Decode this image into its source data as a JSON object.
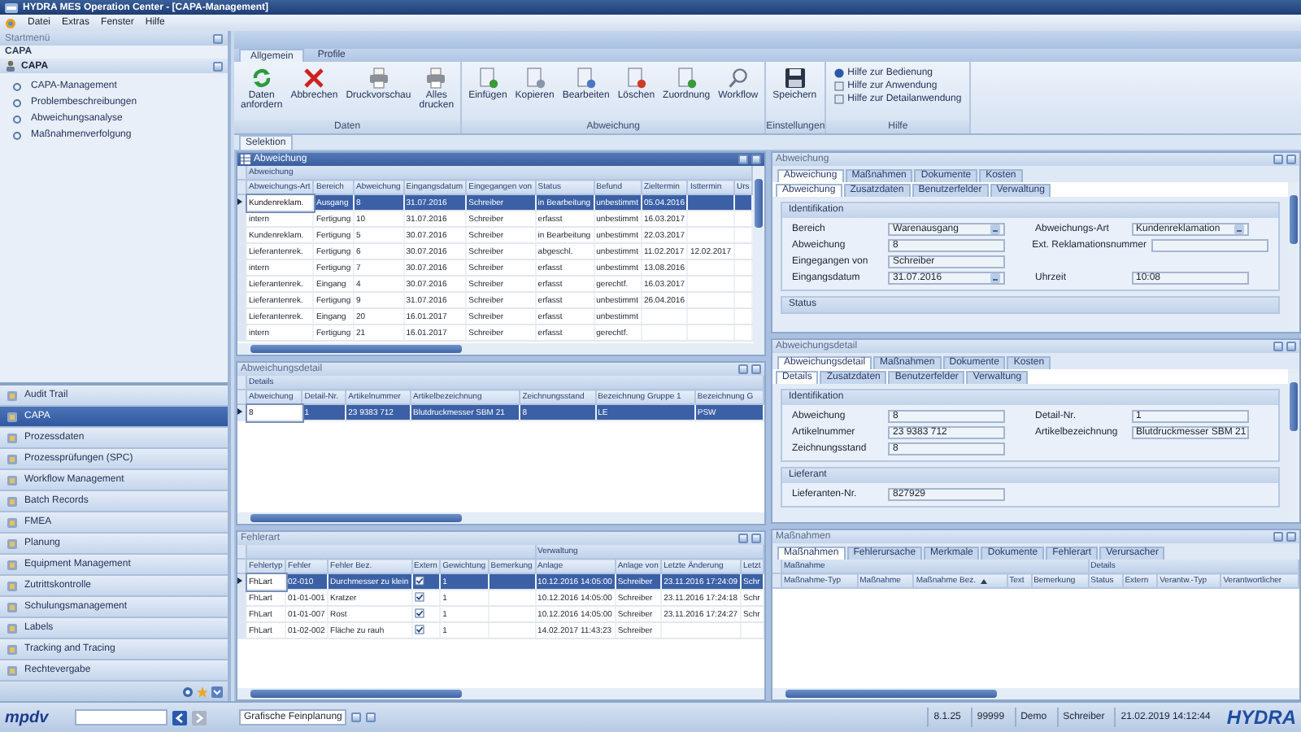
{
  "window": {
    "title": "HYDRA MES Operation Center - [CAPA-Management]"
  },
  "menu": [
    "Datei",
    "Extras",
    "Fenster",
    "Hilfe"
  ],
  "sidebar": {
    "header": "Startmenü",
    "section": "CAPA",
    "group": "CAPA",
    "items": [
      "CAPA-Management",
      "Problembeschreibungen",
      "Abweichungsanalyse",
      "Maßnahmenverfolgung"
    ],
    "modules": [
      {
        "label": "Audit Trail",
        "selected": false
      },
      {
        "label": "CAPA",
        "selected": true
      },
      {
        "label": "Prozessdaten",
        "selected": false
      },
      {
        "label": "Prozessprüfungen (SPC)",
        "selected": false
      },
      {
        "label": "Workflow Management",
        "selected": false
      },
      {
        "label": "Batch Records",
        "selected": false
      },
      {
        "label": "FMEA",
        "selected": false
      },
      {
        "label": "Planung",
        "selected": false
      },
      {
        "label": "Equipment Management",
        "selected": false
      },
      {
        "label": "Zutrittskontrolle",
        "selected": false
      },
      {
        "label": "Schulungsmanagement",
        "selected": false
      },
      {
        "label": "Labels",
        "selected": false
      },
      {
        "label": "Tracking and Tracing",
        "selected": false
      },
      {
        "label": "Rechtevergabe",
        "selected": false
      }
    ]
  },
  "ribbon": {
    "tabs": [
      {
        "label": "Allgemein",
        "selected": true
      },
      {
        "label": "Profile",
        "selected": false
      }
    ],
    "groups": [
      {
        "label": "Daten",
        "buttons": [
          {
            "label": "Daten\nanfordern",
            "kind": "refresh"
          },
          {
            "label": "Abbrechen",
            "kind": "cancel"
          },
          {
            "label": "Druckvorschau",
            "kind": "print"
          },
          {
            "label": "Alles\ndrucken",
            "kind": "print"
          }
        ]
      },
      {
        "label": "Abweichung",
        "buttons": [
          {
            "label": "Einfügen",
            "kind": "add"
          },
          {
            "label": "Kopieren",
            "kind": "copy"
          },
          {
            "label": "Bearbeiten",
            "kind": "edit"
          },
          {
            "label": "Löschen",
            "kind": "delete"
          },
          {
            "label": "Zuordnung",
            "kind": "assign"
          },
          {
            "label": "Workflow",
            "kind": "search"
          }
        ]
      },
      {
        "label": "Einstellungen",
        "buttons": [
          {
            "label": "Speichern",
            "kind": "save"
          }
        ]
      }
    ],
    "help_group": {
      "label": "Hilfe",
      "links": [
        "Hilfe zur Bedienung",
        "Hilfe zur Anwendung",
        "Hilfe zur Detailanwendung"
      ]
    }
  },
  "view_tabs": [
    {
      "label": "Selektion",
      "selected": true
    }
  ],
  "deviations": {
    "title": "Abweichung",
    "bands": [
      "Abweichung"
    ],
    "columns": [
      "Abweichungs-Art",
      "Bereich",
      "Abweichung",
      "Eingangsdatum",
      "Eingegangen von",
      "Status",
      "Befund",
      "Zieltermin",
      "Isttermin",
      "Urs"
    ],
    "rows": [
      {
        "selected": true,
        "cells": [
          "Kundenreklam.",
          "Ausgang",
          "8",
          "31.07.2016",
          "Schreiber",
          "in Bearbeitung",
          "unbestimmt",
          "05.04.2016"
        ]
      },
      {
        "selected": false,
        "cells": [
          "intern",
          "Fertigung",
          "10",
          "31.07.2016",
          "Schreiber",
          "erfasst",
          "unbestimmt",
          "16.03.2017"
        ]
      },
      {
        "selected": false,
        "cells": [
          "Kundenreklam.",
          "Fertigung",
          "5",
          "30.07.2016",
          "Schreiber",
          "in Bearbeitung",
          "unbestimmt",
          "22.03.2017"
        ]
      },
      {
        "selected": false,
        "cells": [
          "Lieferantenrek.",
          "Fertigung",
          "6",
          "30.07.2016",
          "Schreiber",
          "abgeschl.",
          "unbestimmt",
          "11.02.2017",
          "12.02.2017"
        ]
      },
      {
        "selected": false,
        "cells": [
          "intern",
          "Fertigung",
          "7",
          "30.07.2016",
          "Schreiber",
          "erfasst",
          "unbestimmt",
          "13.08.2016"
        ]
      },
      {
        "selected": false,
        "cells": [
          "Lieferantenrek.",
          "Eingang",
          "4",
          "30.07.2016",
          "Schreiber",
          "erfasst",
          "gerechtf.",
          "16.03.2017"
        ]
      },
      {
        "selected": false,
        "cells": [
          "Lieferantenrek.",
          "Fertigung",
          "9",
          "31.07.2016",
          "Schreiber",
          "erfasst",
          "unbestimmt",
          "26.04.2016"
        ]
      },
      {
        "selected": false,
        "cells": [
          "Lieferantenrek.",
          "Eingang",
          "20",
          "16.01.2017",
          "Schreiber",
          "erfasst",
          "unbestimmt"
        ]
      },
      {
        "selected": false,
        "cells": [
          "intern",
          "Fertigung",
          "21",
          "16.01.2017",
          "Schreiber",
          "erfasst",
          "gerechtf."
        ]
      }
    ]
  },
  "deviation_details": {
    "title": "Abweichungsdetail",
    "bands": [
      "Details"
    ],
    "columns": [
      "Abweichung",
      "Detail-Nr.",
      "Artikelnummer",
      "Artikelbezeichnung",
      "Zeichnungsstand",
      "Bezeichnung Gruppe 1",
      "Bezeichnung G"
    ],
    "rows": [
      {
        "selected": true,
        "cells": [
          "8",
          "1",
          "23 9383 712",
          "Blutdruckmesser SBM 21",
          "8",
          "LE",
          "PSW"
        ]
      }
    ]
  },
  "defects": {
    "title": "Fehlerart",
    "bands": [
      "Verwaltung"
    ],
    "columns": [
      "Fehlertyp",
      "Fehler",
      "Fehler Bez.",
      "Extern",
      "Gewichtung",
      "Bemerkung",
      "Anlage",
      "Anlage von",
      "Letzte Änderung",
      "Letzt"
    ],
    "rows": [
      {
        "selected": true,
        "cells": [
          "FhLart",
          "02-010",
          "Durchmesser zu klein",
          true,
          "1",
          null,
          "10.12.2016 14:05:00",
          "Schreiber",
          "23.11.2016 17:24:09",
          "Schr"
        ]
      },
      {
        "selected": false,
        "cells": [
          "FhLart",
          "01-01-001",
          "Kratzer",
          true,
          "1",
          null,
          "10.12.2016 14:05:00",
          "Schreiber",
          "23.11.2016 17:24:18",
          "Schr"
        ]
      },
      {
        "selected": false,
        "cells": [
          "FhLart",
          "01-01-007",
          "Rost",
          true,
          "1",
          null,
          "10.12.2016 14:05:00",
          "Schreiber",
          "23.11.2016 17:24:27",
          "Schr"
        ]
      },
      {
        "selected": false,
        "cells": [
          "FhLart",
          "01-02-002",
          "Fläche zu rauh",
          true,
          "1",
          null,
          "14.02.2017 11:43:23",
          "Schreiber"
        ]
      }
    ]
  },
  "deviation_form": {
    "title": "Abweichung",
    "tabs": [
      {
        "label": "Abweichung",
        "selected": true
      },
      {
        "label": "Maßnahmen",
        "selected": false
      },
      {
        "label": "Dokumente",
        "selected": false
      },
      {
        "label": "Kosten",
        "selected": false
      }
    ],
    "subtabs": [
      {
        "label": "Abweichung",
        "selected": true
      },
      {
        "label": "Zusatzdaten",
        "selected": false
      },
      {
        "label": "Benutzerfelder",
        "selected": false
      },
      {
        "label": "Verwaltung",
        "selected": false
      }
    ],
    "sections": [
      {
        "title": "Identifikation",
        "rows": [
          [
            {
              "label": "Bereich",
              "value": "Warenausgang",
              "kind": "dropdown"
            },
            {
              "label": "Abweichungs-Art",
              "value": "Kundenreklamation",
              "kind": "dropdown"
            }
          ],
          [
            {
              "label": "Abweichung",
              "value": "8",
              "kind": "text"
            },
            {
              "label": "Ext. Reklamationsnummer",
              "kind": "text"
            }
          ],
          [
            {
              "label": "Eingegangen von",
              "value": "Schreiber",
              "kind": "text"
            }
          ],
          [
            {
              "label": "Eingangsdatum",
              "value": "31.07.2016",
              "kind": "dropdown"
            },
            {
              "label": "Uhrzeit",
              "value": "10:08",
              "kind": "text"
            }
          ]
        ]
      },
      {
        "title": "Status"
      }
    ]
  },
  "detail_form": {
    "title": "Abweichungsdetail",
    "tabs": [
      {
        "label": "Abweichungsdetail",
        "selected": true
      },
      {
        "label": "Maßnahmen",
        "selected": false
      },
      {
        "label": "Dokumente",
        "selected": false
      },
      {
        "label": "Kosten",
        "selected": false
      }
    ],
    "subtabs": [
      {
        "label": "Details",
        "selected": true
      },
      {
        "label": "Zusatzdaten",
        "selected": false
      },
      {
        "label": "Benutzerfelder",
        "selected": false
      },
      {
        "label": "Verwaltung",
        "selected": false
      }
    ],
    "sections": [
      {
        "title": "Identifikation",
        "rows": [
          [
            {
              "label": "Abweichung",
              "value": "8",
              "kind": "text"
            },
            {
              "label": "Detail-Nr.",
              "value": "1",
              "kind": "text"
            }
          ],
          [
            {
              "label": "Artikelnummer",
              "value": "23 9383 712",
              "kind": "text"
            },
            {
              "label": "Artikelbezeichnung",
              "value": "Blutdruckmesser SBM 21",
              "kind": "text"
            }
          ],
          [
            {
              "label": "Zeichnungsstand",
              "value": "8",
              "kind": "text"
            }
          ]
        ]
      },
      {
        "title": "Lieferant",
        "rows": [
          [
            {
              "label": "Lieferanten-Nr.",
              "value": "827929",
              "kind": "text"
            }
          ]
        ]
      }
    ]
  },
  "measures": {
    "title": "Maßnahmen",
    "tabs": [
      {
        "label": "Maßnahmen",
        "selected": true
      },
      {
        "label": "Fehlerursache",
        "selected": false
      },
      {
        "label": "Merkmale",
        "selected": false
      },
      {
        "label": "Dokumente",
        "selected": false
      },
      {
        "label": "Fehlerart",
        "selected": false
      },
      {
        "label": "Verursacher",
        "selected": false
      }
    ],
    "bands": [
      "Maßnahme",
      "Details"
    ],
    "columns": [
      {
        "label": "Maßnahme-Typ"
      },
      {
        "label": "Maßnahme"
      },
      {
        "label": "Maßnahme Bez.",
        "sorted": true
      },
      {
        "label": "Text"
      },
      {
        "label": "Bemerkung"
      },
      {
        "label": "Status"
      },
      {
        "label": "Extern"
      },
      {
        "label": "Verantw.-Typ"
      },
      {
        "label": "Verantwortlicher"
      }
    ]
  },
  "status_bar": {
    "logo": "mpdv",
    "view": "Grafische Feinplanung",
    "cells": [
      "8.1.25",
      "99999",
      "Demo",
      "Schreiber",
      "21.02.2019 14:12:44"
    ],
    "brand": "HYDRA"
  }
}
